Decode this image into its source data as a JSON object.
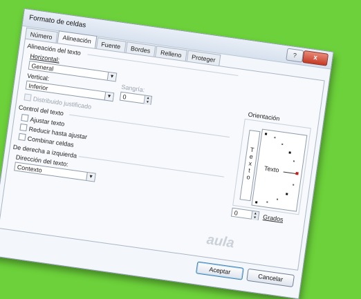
{
  "dialog": {
    "title": "Formato de celdas",
    "help_label": "?",
    "close_label": "x"
  },
  "tabs": [
    "Número",
    "Alineación",
    "Fuente",
    "Bordes",
    "Relleno",
    "Proteger"
  ],
  "alignment": {
    "section_title": "Alineación del texto",
    "horizontal_label": "Horizontal:",
    "horizontal_value": "General",
    "vertical_label": "Vertical:",
    "vertical_value": "Inferior",
    "indent_label": "Sangría:",
    "indent_value": "0",
    "distributed_label": "Distribuido justificado"
  },
  "text_control": {
    "section_title": "Control del texto",
    "wrap_label": "Ajustar texto",
    "shrink_label": "Reducir hasta ajustar",
    "merge_label": "Combinar celdas"
  },
  "rtl": {
    "section_title": "De derecha a izquierda",
    "direction_label": "Dirección del texto:",
    "direction_value": "Contexto"
  },
  "orientation": {
    "section_title": "Orientación",
    "vertical_letters": [
      "T",
      "e",
      "x",
      "t",
      "o"
    ],
    "dial_text": "Texto",
    "degrees_value": "0",
    "degrees_label": "Grados"
  },
  "buttons": {
    "accept": "Aceptar",
    "cancel": "Cancelar"
  },
  "watermark": "aula"
}
